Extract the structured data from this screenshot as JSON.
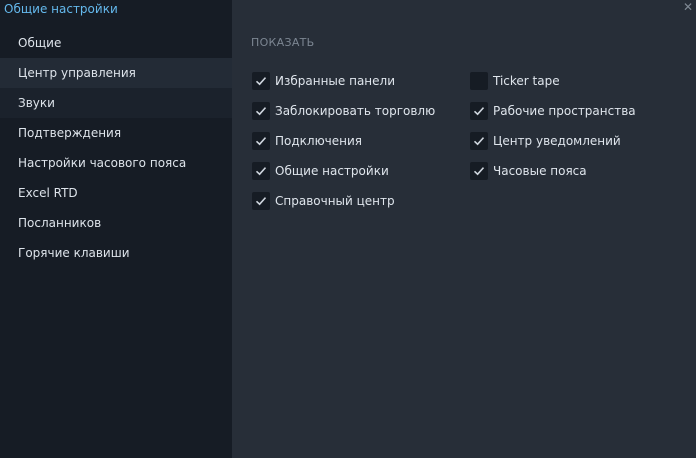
{
  "window": {
    "title": "Общие настройки"
  },
  "sidebar": {
    "items": [
      {
        "label": "Общие"
      },
      {
        "label": "Центр управления"
      },
      {
        "label": "Звуки"
      },
      {
        "label": "Подтверждения"
      },
      {
        "label": "Настройки часового пояса"
      },
      {
        "label": "Excel RTD"
      },
      {
        "label": "Посланников"
      },
      {
        "label": "Горячие клавиши"
      }
    ],
    "active_index": 1
  },
  "content": {
    "section_title": "ПОКАЗАТЬ",
    "left_options": [
      {
        "label": "Избранные панели",
        "checked": true
      },
      {
        "label": "Заблокировать торговлю",
        "checked": true
      },
      {
        "label": "Подключения",
        "checked": true
      },
      {
        "label": "Общие настройки",
        "checked": true
      },
      {
        "label": "Справочный центр",
        "checked": true
      }
    ],
    "right_options": [
      {
        "label": "Ticker tape",
        "checked": false
      },
      {
        "label": "Рабочие пространства",
        "checked": true
      },
      {
        "label": "Центр уведомлений",
        "checked": true
      },
      {
        "label": "Часовые пояса",
        "checked": true
      }
    ]
  },
  "icons": {
    "close": "close-icon",
    "check": "checkmark-icon"
  },
  "colors": {
    "accent": "#64b8ec",
    "sidebar_bg": "#161c25",
    "sidebar_active": "#232b36",
    "content_bg": "#272e38",
    "checkbox_bg": "#161c24",
    "checkmark": "#cfd6de"
  }
}
